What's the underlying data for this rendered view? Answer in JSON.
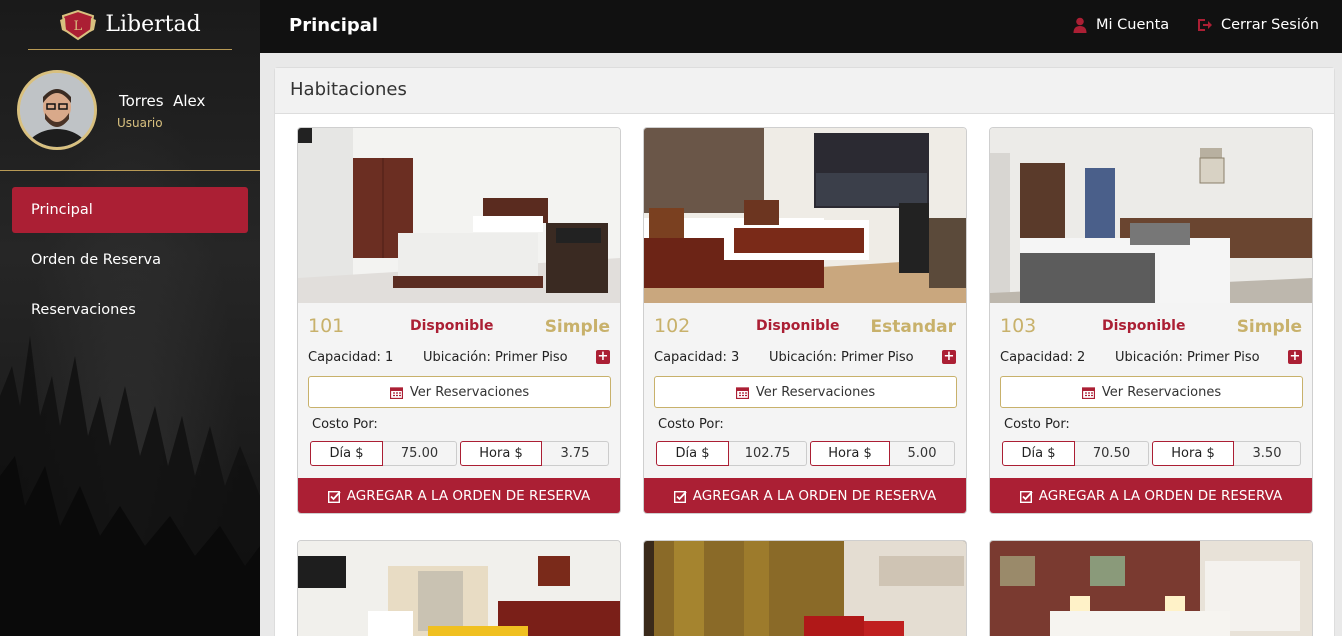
{
  "brand": {
    "name": "Libertad",
    "logo_icon": "shield-logo-icon"
  },
  "user": {
    "first_name": "Torres",
    "last_name": "Alex",
    "role": "Usuario"
  },
  "nav": {
    "items": [
      {
        "label": "Principal",
        "active": true
      },
      {
        "label": "Orden de Reserva",
        "active": false
      },
      {
        "label": "Reservaciones",
        "active": false
      }
    ]
  },
  "topbar": {
    "title": "Principal",
    "account_label": "Mi Cuenta",
    "logout_label": "Cerrar Sesión"
  },
  "panel": {
    "title": "Habitaciones"
  },
  "rooms": [
    {
      "number": "101",
      "status": "Disponible",
      "type": "Simple",
      "capacity": "Capacidad: 1",
      "location": "Ubicación: Primer Piso",
      "view_label": "Ver Reservaciones",
      "cost_label": "Costo Por:",
      "day_label": "Día $",
      "day_price": "75.00",
      "hour_label": "Hora $",
      "hour_price": "3.75",
      "add_label": "AGREGAR A LA ORDEN DE RESERVA"
    },
    {
      "number": "102",
      "status": "Disponible",
      "type": "Estandar",
      "capacity": "Capacidad: 3",
      "location": "Ubicación: Primer Piso",
      "view_label": "Ver Reservaciones",
      "cost_label": "Costo Por:",
      "day_label": "Día $",
      "day_price": "102.75",
      "hour_label": "Hora $",
      "hour_price": "5.00",
      "add_label": "AGREGAR A LA ORDEN DE RESERVA"
    },
    {
      "number": "103",
      "status": "Disponible",
      "type": "Simple",
      "capacity": "Capacidad: 2",
      "location": "Ubicación: Primer Piso",
      "view_label": "Ver Reservaciones",
      "cost_label": "Costo Por:",
      "day_label": "Día $",
      "day_price": "70.50",
      "hour_label": "Hora $",
      "hour_price": "3.50",
      "add_label": "AGREGAR A LA ORDEN DE RESERVA"
    }
  ],
  "colors": {
    "accent": "#ab1f34",
    "gold": "#c8b16b",
    "dark": "#111111"
  }
}
